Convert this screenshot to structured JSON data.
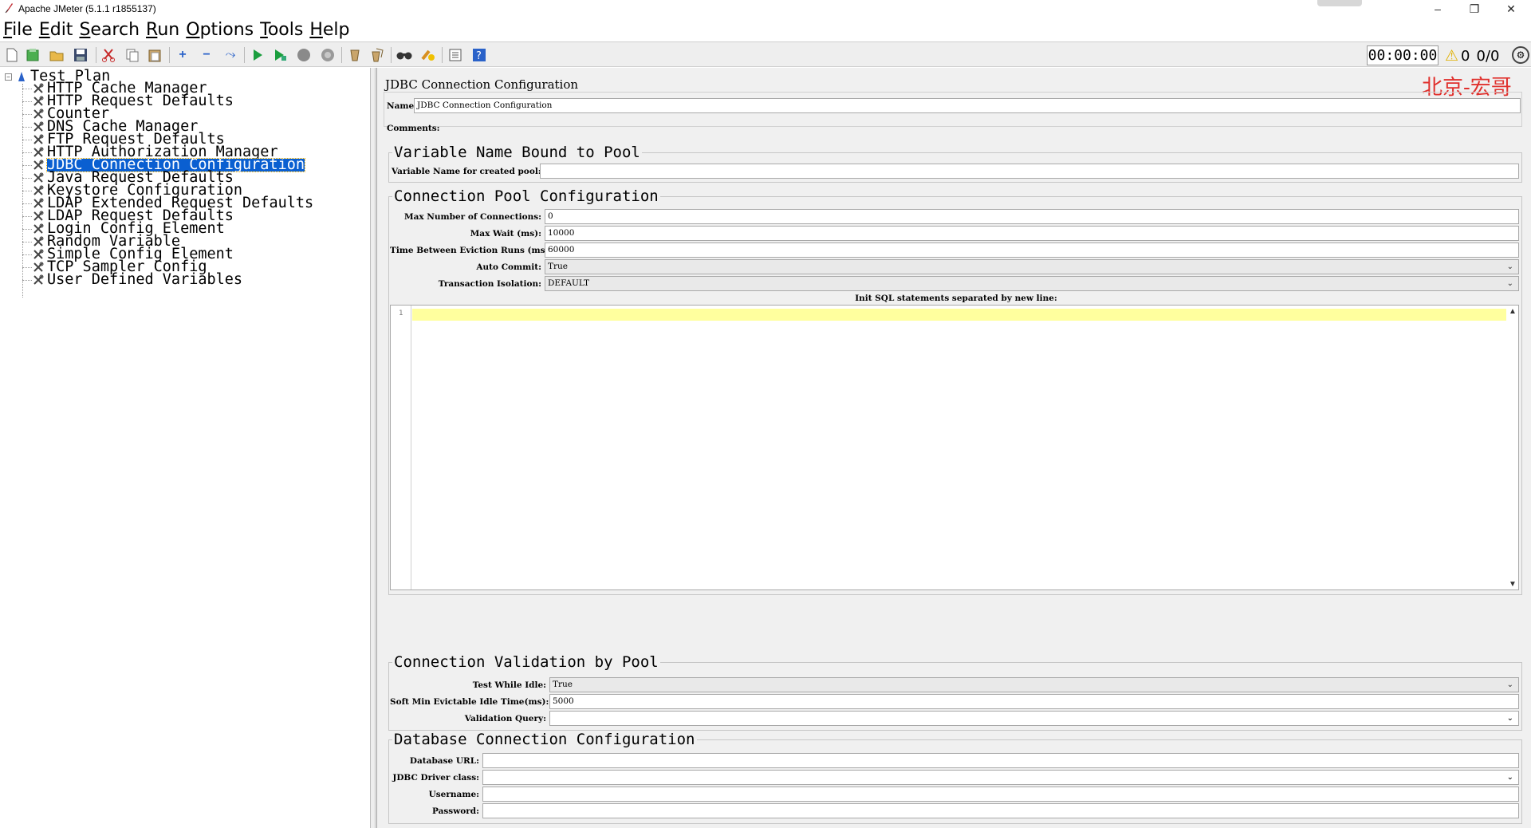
{
  "window": {
    "title": "Apache JMeter (5.1.1 r1855137)",
    "minimize_glyph": "–",
    "maximize_glyph": "❐",
    "close_glyph": "✕"
  },
  "menu": [
    "File",
    "Edit",
    "Search",
    "Run",
    "Options",
    "Tools",
    "Help"
  ],
  "toolbar": {
    "icons": [
      "new-icon",
      "templates-icon",
      "open-icon",
      "save-icon",
      "cut-icon",
      "copy-icon",
      "paste-icon",
      "expand-icon",
      "collapse-icon",
      "toggle-icon",
      "start-icon",
      "start-no-pauses-icon",
      "stop-icon",
      "shutdown-icon",
      "clear-icon",
      "clear-all-icon",
      "search-icon",
      "reset-search-icon",
      "function-helper-icon",
      "help-icon"
    ],
    "timer": "00:00:00",
    "warning_count": "0",
    "thread_count": "0/0"
  },
  "tree": {
    "root": "Test Plan",
    "expand_glyph": "−",
    "items": [
      "HTTP Cache Manager",
      "HTTP Request Defaults",
      "Counter",
      "DNS Cache Manager",
      "FTP Request Defaults",
      "HTTP Authorization Manager",
      "JDBC Connection Configuration",
      "Java Request Defaults",
      "Keystore Configuration",
      "LDAP Extended Request Defaults",
      "LDAP Request Defaults",
      "Login Config Element",
      "Random Variable",
      "Simple Config Element",
      "TCP Sampler Config",
      "User Defined Variables"
    ],
    "selected_index": 6
  },
  "panel": {
    "title": "JDBC Connection Configuration",
    "watermark": "北京-宏哥",
    "name_label": "Name:",
    "name_value": "JDBC Connection Configuration",
    "comments_label": "Comments:",
    "comments_value": "",
    "variable_group": {
      "title": "Variable Name Bound to Pool",
      "var_label": "Variable Name for created pool:",
      "var_value": ""
    },
    "pool_group": {
      "title": "Connection Pool Configuration",
      "max_conn_label": "Max Number of Connections:",
      "max_conn_value": "0",
      "max_wait_label": "Max Wait (ms):",
      "max_wait_value": "10000",
      "eviction_label": "Time Between Eviction Runs (ms):",
      "eviction_value": "60000",
      "auto_commit_label": "Auto Commit:",
      "auto_commit_value": "True",
      "isolation_label": "Transaction Isolation:",
      "isolation_value": "DEFAULT",
      "init_sql_label": "Init SQL statements separated by new line:",
      "init_sql_line": "1"
    },
    "validation_group": {
      "title": "Connection Validation by Pool",
      "test_idle_label": "Test While Idle:",
      "test_idle_value": "True",
      "soft_min_label": "Soft Min Evictable Idle Time(ms):",
      "soft_min_value": "5000",
      "query_label": "Validation Query:",
      "query_value": ""
    },
    "db_group": {
      "title": "Database Connection Configuration",
      "url_label": "Database URL:",
      "url_value": "",
      "driver_label": "JDBC Driver class:",
      "driver_value": "",
      "user_label": "Username:",
      "user_value": "",
      "password_label": "Password:",
      "password_value": ""
    }
  },
  "colors": {
    "selection": "#0a5fd1",
    "watermark": "#e0302c",
    "editor_highlight": "#ffff9e"
  }
}
